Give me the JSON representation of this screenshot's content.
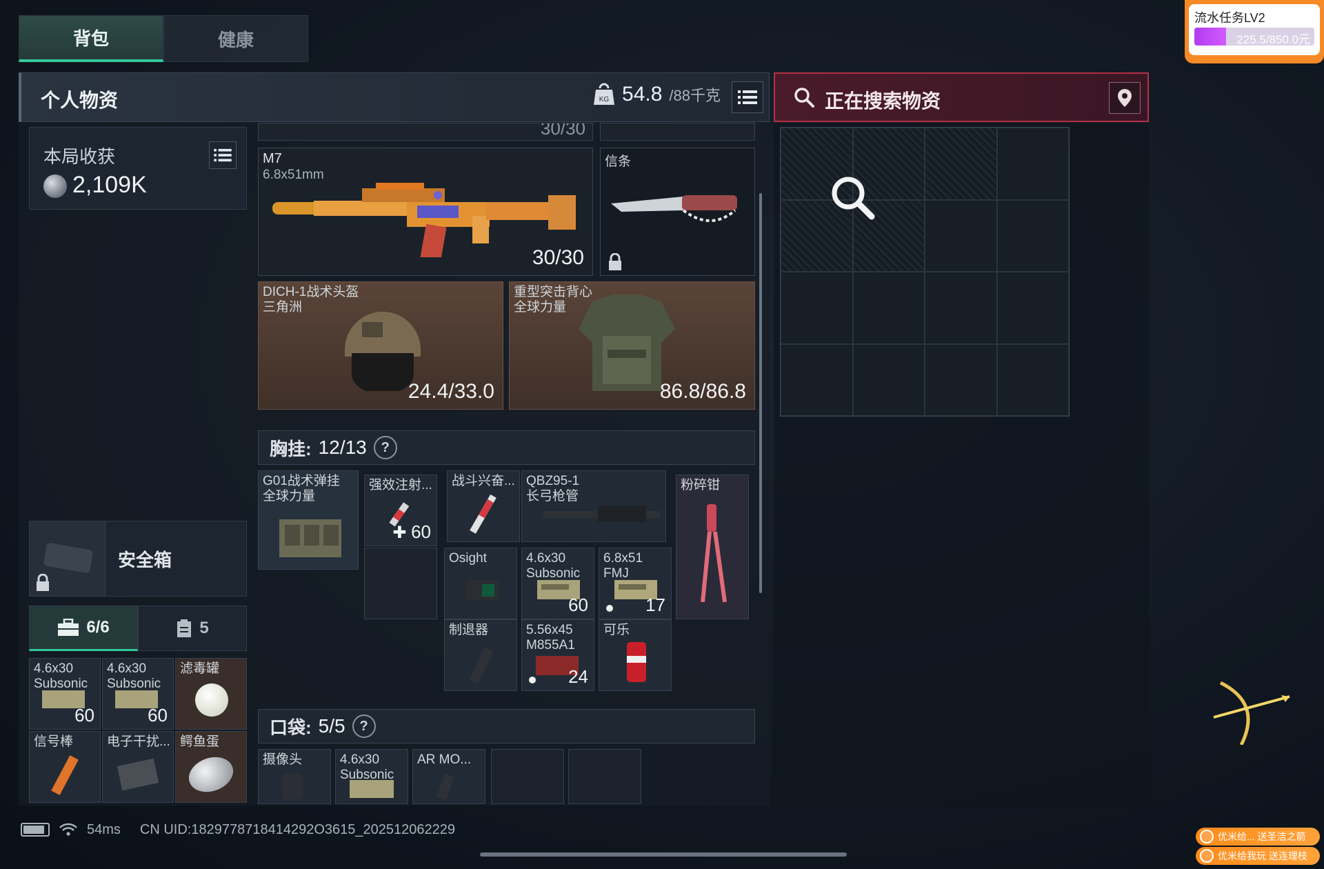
{
  "tabs": [
    {
      "label": "背包",
      "active": true
    },
    {
      "label": "健康",
      "active": false
    }
  ],
  "personal": {
    "title": "个人物资",
    "weight_current": "54.8",
    "weight_max": "/88千克"
  },
  "search": {
    "title": "正在搜索物资"
  },
  "loot": {
    "label": "本局收获",
    "value": "2,109K"
  },
  "weapon": {
    "name": "M7",
    "caliber": "6.8x51mm",
    "ammo": "30/30",
    "top_partial": "30/30"
  },
  "melee": {
    "name": "信条"
  },
  "helmet": {
    "name": "DICH-1战术头盔",
    "sub": "三角洲",
    "durability": "24.4/33.0"
  },
  "armor": {
    "name": "重型突击背心",
    "sub": "全球力量",
    "durability": "86.8/86.8"
  },
  "chest_rig": {
    "label": "胸挂:",
    "value": "12/13",
    "help": "?"
  },
  "rig_slots": [
    {
      "name": "G01战术弹挂\n全球力量",
      "count": ""
    },
    {
      "name": "强效注射...",
      "count": "60"
    },
    {
      "name": "战斗兴奋...",
      "count": ""
    },
    {
      "name": "QBZ95-1\n长弓枪管",
      "count": ""
    },
    {
      "name": "粉碎钳",
      "count": ""
    },
    {
      "name": "Osight",
      "count": ""
    },
    {
      "name": "4.6x30\nSubsonic",
      "count": "60"
    },
    {
      "name": "6.8x51\nFMJ",
      "count": "17"
    },
    {
      "name": "制退器",
      "count": ""
    },
    {
      "name": "5.56x45\nM855A1",
      "count": "24"
    },
    {
      "name": "可乐",
      "count": ""
    }
  ],
  "pocket": {
    "label": "口袋:",
    "value": "5/5",
    "help": "?"
  },
  "pocket_slots": [
    {
      "name": "摄像头"
    },
    {
      "name": "4.6x30\nSubsonic"
    },
    {
      "name": "AR MO..."
    }
  ],
  "safe": {
    "label": "安全箱"
  },
  "container_tabs": [
    {
      "label": "6/6",
      "icon": "toolbox-icon",
      "active": true
    },
    {
      "label": "5",
      "icon": "clipboard-icon",
      "active": false
    }
  ],
  "safe_items": [
    {
      "name": "4.6x30\nSubsonic",
      "count": "60"
    },
    {
      "name": "4.6x30\nSubsonic",
      "count": "60"
    },
    {
      "name": "滤毒罐",
      "count": ""
    },
    {
      "name": "信号棒",
      "count": ""
    },
    {
      "name": "电子干扰...",
      "count": ""
    },
    {
      "name": "鳄鱼蛋",
      "count": ""
    }
  ],
  "status": {
    "ping": "54ms",
    "uid": "CN UID:1829778718414292O3615_202512062229"
  },
  "quest": {
    "title": "流水任务LV2",
    "progress_text": "225.5/850.0元",
    "progress": 0.265
  },
  "live": [
    {
      "text": "优米给... 送圣洁之箭"
    },
    {
      "text": "优米给我玩 送连理枝"
    }
  ],
  "colors": {
    "accent_green": "#34c89a",
    "search_red": "#b23147",
    "quest_orange": "#f58a26",
    "quest_purple": "#b13cf0"
  }
}
